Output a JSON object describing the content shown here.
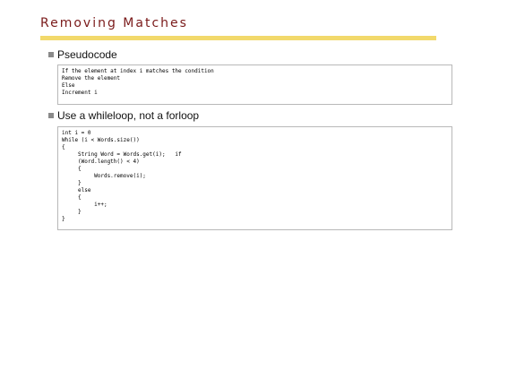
{
  "slide": {
    "title": "Removing Matches"
  },
  "bullets": [
    {
      "label": "Pseudocode",
      "code": [
        "If the element at index i matches the condition",
        "Remove the element",
        "Else",
        "Increment i"
      ]
    },
    {
      "label": "Use a whileloop, not a forloop",
      "code": [
        "int i = 0",
        "While (i < Words.size())",
        "{",
        "     String Word = Words.get(i);   if",
        "     (Word.length() < 4)",
        "     {",
        "          Words.remove(i);",
        "     }",
        "     else",
        "     {",
        "          i++;",
        "     }",
        "}"
      ]
    }
  ],
  "colors": {
    "title": "#7a1a1a",
    "rule": "#f2d96b",
    "bullet": "#8a8a8a",
    "box_border": "#b8b8b8"
  }
}
